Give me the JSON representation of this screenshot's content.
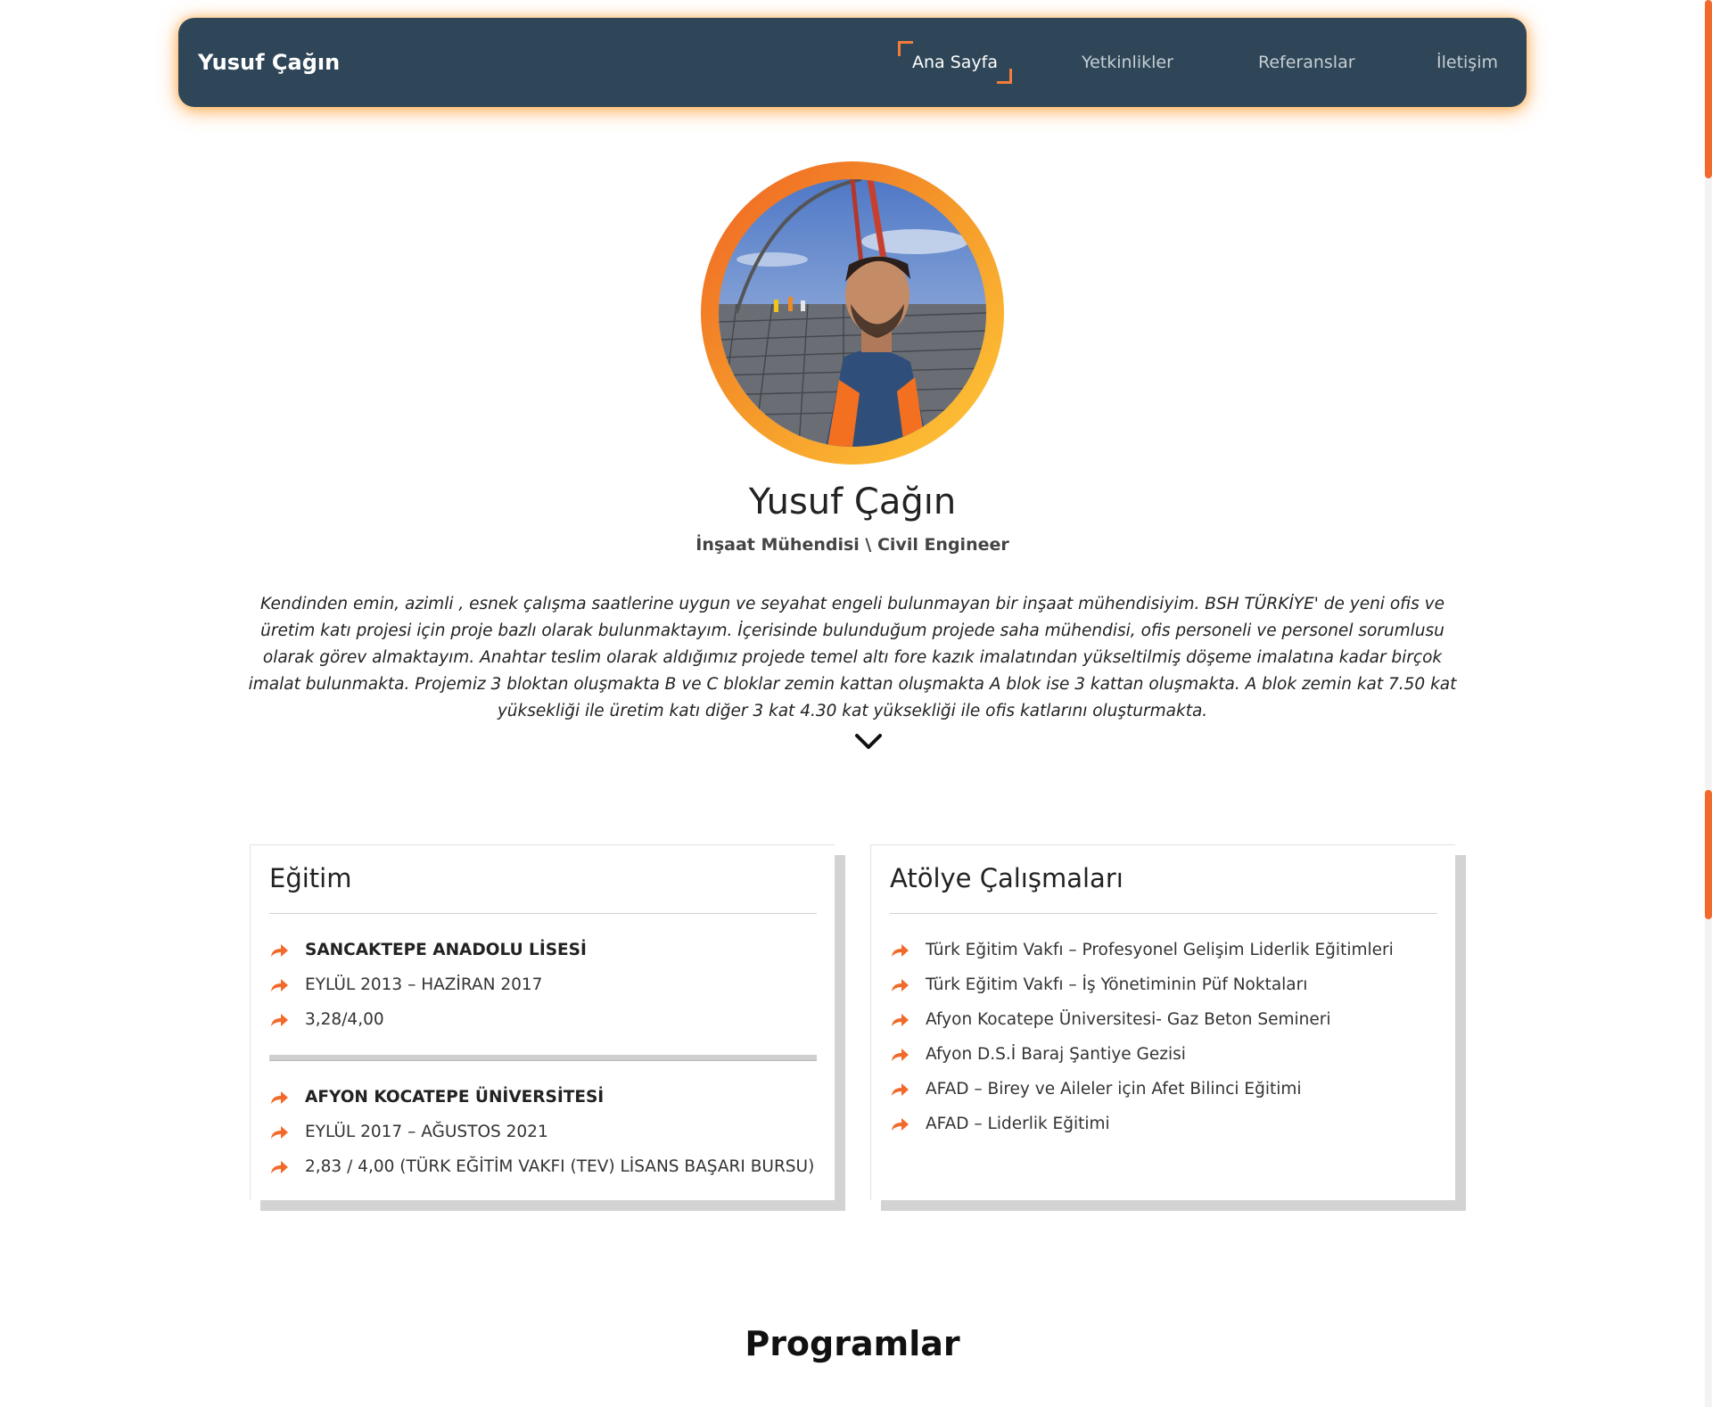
{
  "navbar": {
    "brand": "Yusuf Çağın",
    "links": [
      {
        "label": "Ana Sayfa",
        "active": true
      },
      {
        "label": "Yetkinlikler",
        "active": false
      },
      {
        "label": "Referanslar",
        "active": false
      },
      {
        "label": "İletişim",
        "active": false
      }
    ]
  },
  "profile": {
    "name": "Yusuf Çağın",
    "title": "İnşaat Mühendisi \\ Civil Engineer",
    "bio": "Kendinden emin, azimli , esnek çalışma saatlerine uygun ve seyahat engeli bulunmayan bir inşaat mühendisiyim. BSH TÜRKİYE' de yeni ofis ve üretim katı projesi için proje bazlı olarak bulunmaktayım. İçerisinde bulunduğum projede saha mühendisi, ofis personeli ve personel sorumlusu olarak görev almaktayım. Anahtar teslim olarak aldığımız projede temel altı fore kazık imalatından yükseltilmiş döşeme imalatına kadar birçok imalat bulunmakta. Projemiz 3 bloktan oluşmakta B ve C bloklar zemin kattan oluşmakta A blok ise 3 kattan oluşmakta. A blok zemin kat 7.50 kat yüksekliği ile üretim katı diğer 3 kat 4.30 kat yüksekliği ile ofis katlarını oluşturmakta."
  },
  "education": {
    "title": "Eğitim",
    "schools": [
      {
        "name": "SANCAKTEPE ANADOLU LİSESİ",
        "period": "EYLÜL 2013 – HAZİRAN 2017",
        "grade": "3,28/4,00"
      },
      {
        "name": "AFYON KOCATEPE ÜNİVERSİTESİ",
        "period": "EYLÜL 2017 – AĞUSTOS 2021",
        "grade": "2,83 / 4,00 (TÜRK EĞİTİM VAKFI (TEV) LİSANS BAŞARI BURSU)"
      }
    ]
  },
  "workshops": {
    "title": "Atölye Çalışmaları",
    "items": [
      "Türk Eğitim Vakfı – Profesyonel Gelişim Liderlik Eğitimleri",
      "Türk Eğitim Vakfı – İş Yönetiminin Püf Noktaları",
      "Afyon Kocatepe Üniversitesi- Gaz Beton Semineri",
      "Afyon D.S.İ Baraj Şantiye Gezisi",
      "AFAD – Birey ve Aileler için Afet Bilinci Eğitimi",
      "AFAD – Liderlik Eğitimi"
    ]
  },
  "programs": {
    "heading": "Programlar"
  },
  "colors": {
    "navbar_bg": "#2e4657",
    "accent": "#f26a2b",
    "gradient_start": "#ef6324",
    "gradient_end": "#ffc938"
  },
  "icons": {
    "list_bullet": "share-arrow-icon",
    "scroll_down": "chevron-down-icon"
  }
}
